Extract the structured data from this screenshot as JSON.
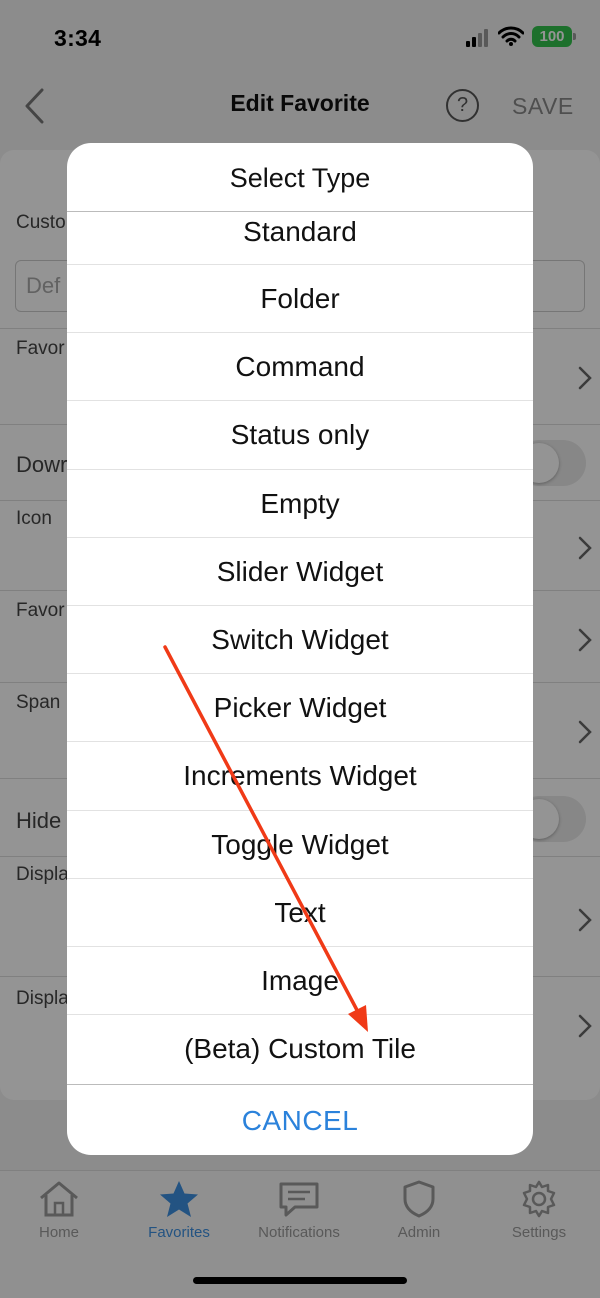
{
  "status_bar": {
    "time": "3:34",
    "battery": "100"
  },
  "nav": {
    "title": "Edit Favorite",
    "help": "?",
    "save": "SAVE"
  },
  "form": {
    "custom_label": "Custo",
    "custom_placeholder": "Def",
    "favorite_label": "Favor",
    "download_label": "Dowr",
    "icon_label": "Icon",
    "favorite2_label": "Favor",
    "span_label": "Span",
    "hide_label": "Hide",
    "display_label": "Displa",
    "display2_label": "Displa"
  },
  "dialog": {
    "title": "Select Type",
    "options": [
      "Standard",
      "Folder",
      "Command",
      "Status only",
      "Empty",
      "Slider Widget",
      "Switch Widget",
      "Picker Widget",
      "Increments Widget",
      "Toggle Widget",
      "Text",
      "Image",
      "(Beta) Custom Tile"
    ],
    "cancel": "CANCEL"
  },
  "tabbar": {
    "items": [
      {
        "label": "Home",
        "icon": "home-icon"
      },
      {
        "label": "Favorites",
        "icon": "star-icon"
      },
      {
        "label": "Notifications",
        "icon": "chat-icon"
      },
      {
        "label": "Admin",
        "icon": "shield-icon"
      },
      {
        "label": "Settings",
        "icon": "gear-icon"
      }
    ],
    "active": "Favorites"
  },
  "colors": {
    "accent": "#2b82db",
    "battery": "#33c24d",
    "annotation_arrow": "#f03a17"
  }
}
